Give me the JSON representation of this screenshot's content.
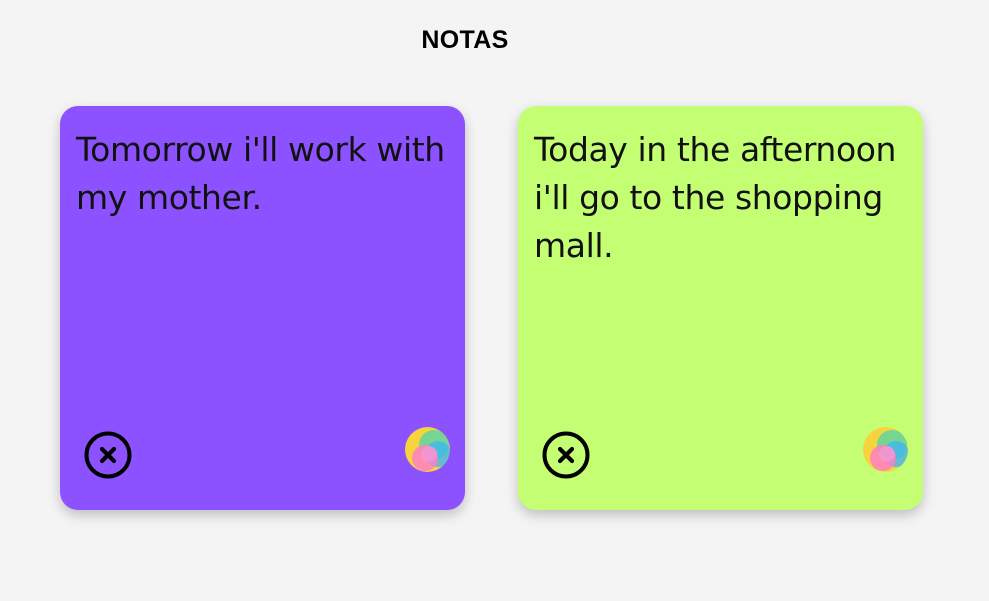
{
  "header": {
    "title": "NOTAS"
  },
  "notes": [
    {
      "text": "Tomorrow i'll work with my mother.",
      "color": "#8c52ff",
      "delete_icon": "close-circle-icon",
      "color_icon": "color-palette-icon"
    },
    {
      "text": "Today in the afternoon i'll go to the shopping mall.",
      "color": "#c4ff73",
      "delete_icon": "close-circle-icon",
      "color_icon": "color-palette-icon"
    }
  ],
  "colors": {
    "background": "#f4f4f4",
    "text": "#111111"
  }
}
